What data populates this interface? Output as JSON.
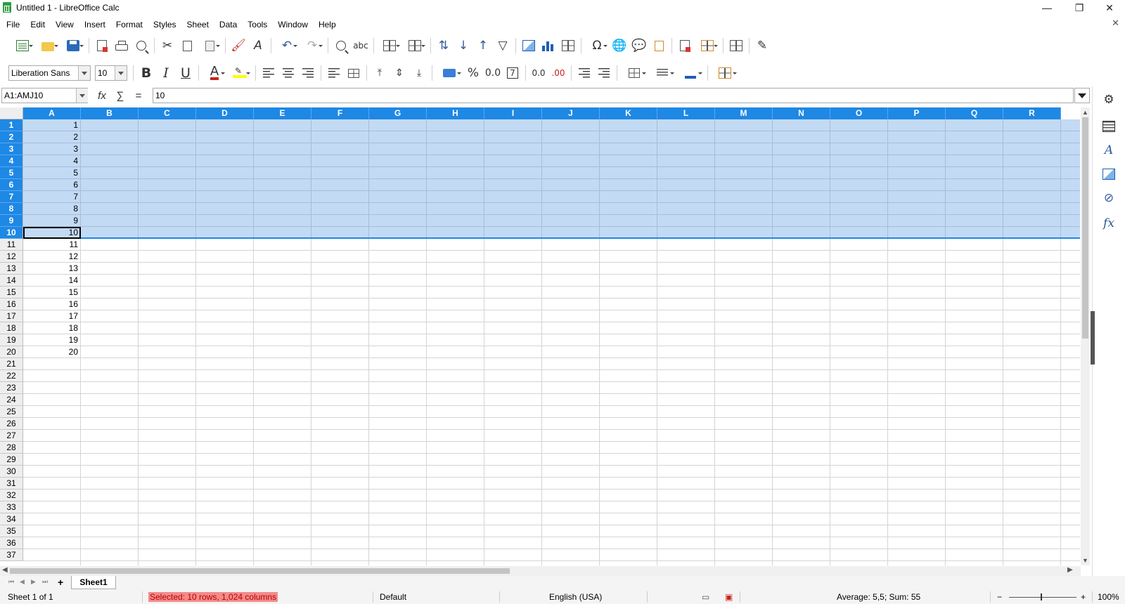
{
  "window": {
    "title": "Untitled 1 - LibreOffice Calc",
    "min": "—",
    "restore": "❐",
    "close": "✕"
  },
  "menu": [
    "File",
    "Edit",
    "View",
    "Insert",
    "Format",
    "Styles",
    "Sheet",
    "Data",
    "Tools",
    "Window",
    "Help"
  ],
  "doc_close": "✕",
  "formatting": {
    "font_name": "Liberation Sans",
    "font_size": "10",
    "bold": "B",
    "italic": "I",
    "underline": "U",
    "font_color": "A",
    "percent": "%",
    "decimal": "0.0",
    "date": "7",
    "add_dec": "0.0",
    "del_dec": ".00"
  },
  "formula_bar": {
    "name_box": "A1:AMJ10",
    "fx": "fx",
    "sum": "∑",
    "equals": "=",
    "content": "10"
  },
  "columns": [
    "A",
    "B",
    "C",
    "D",
    "E",
    "F",
    "G",
    "H",
    "I",
    "J",
    "K",
    "L",
    "M",
    "N",
    "O",
    "P",
    "Q",
    "R"
  ],
  "rows": [
    "1",
    "2",
    "3",
    "4",
    "5",
    "6",
    "7",
    "8",
    "9",
    "10",
    "11",
    "12",
    "13",
    "14",
    "15",
    "16",
    "17",
    "18",
    "19",
    "20",
    "21",
    "22",
    "23",
    "24",
    "25",
    "26",
    "27",
    "28",
    "29",
    "30",
    "31",
    "32",
    "33",
    "34",
    "35",
    "36",
    "37"
  ],
  "col_a_values": [
    "1",
    "2",
    "3",
    "4",
    "5",
    "6",
    "7",
    "8",
    "9",
    "10",
    "11",
    "12",
    "13",
    "14",
    "15",
    "16",
    "17",
    "18",
    "19",
    "20"
  ],
  "selected_rows": 10,
  "sheet_tabs": [
    "Sheet1"
  ],
  "status": {
    "sheet": "Sheet 1 of 1",
    "selection": "Selected: 10 rows, 1,024 columns",
    "page_style": "Default",
    "language": "English (USA)",
    "summary": "Average: 5,5; Sum: 55",
    "zoom": "100%"
  },
  "colors": {
    "accent": "#1e88e5",
    "selection": "#b5d4f3",
    "status_highlight": "#f28b8b"
  },
  "icons": [
    "new-icon",
    "open-icon",
    "save-icon",
    "export-pdf-icon",
    "print-icon",
    "print-preview-icon",
    "cut-icon",
    "copy-icon",
    "paste-icon",
    "clone-format-icon",
    "clear-format-icon",
    "undo-icon",
    "redo-icon",
    "find-replace-icon",
    "spelling-icon",
    "row-icon",
    "column-icon",
    "sort-icon",
    "sort-ascending-icon",
    "sort-descending-icon",
    "autofilter-icon",
    "image-icon",
    "chart-icon",
    "pivot-table-icon",
    "special-character-icon",
    "hyperlink-icon",
    "comment-icon",
    "header-footer-icon",
    "define-print-area-icon",
    "freeze-rows-icon",
    "split-window-icon",
    "show-draw-icon"
  ]
}
